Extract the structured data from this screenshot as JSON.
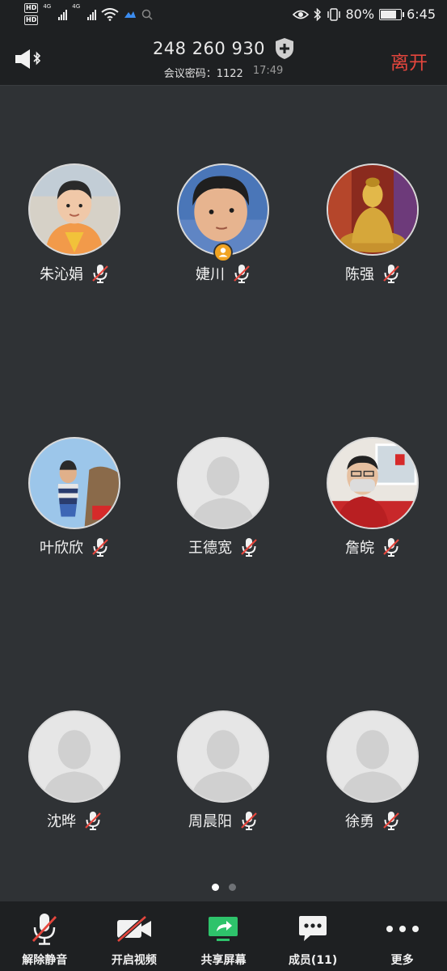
{
  "status_bar": {
    "hd_badges": [
      "HD",
      "HD"
    ],
    "network_labels": [
      "4G",
      "4G"
    ],
    "battery_percent": "80%",
    "battery_level": 0.8,
    "time": "6:45"
  },
  "header": {
    "meeting_id": "248 260 930",
    "password_label": "会议密码：",
    "password_value": "1122",
    "duration": "17:49",
    "leave_label": "离开"
  },
  "participants": [
    {
      "name": "朱沁娟",
      "avatar": "photo-child",
      "muted": true,
      "host": false
    },
    {
      "name": "婕川",
      "avatar": "photo-child-closeup",
      "muted": true,
      "host": true
    },
    {
      "name": "陈强",
      "avatar": "photo-buddha",
      "muted": true,
      "host": false
    },
    {
      "name": "叶欣欣",
      "avatar": "photo-child-outdoor",
      "muted": true,
      "host": false
    },
    {
      "name": "王德宽",
      "avatar": "default",
      "muted": true,
      "host": false
    },
    {
      "name": "詹皖",
      "avatar": "photo-person-mask",
      "muted": true,
      "host": false
    },
    {
      "name": "沈晔",
      "avatar": "default",
      "muted": true,
      "host": false
    },
    {
      "name": "周晨阳",
      "avatar": "default",
      "muted": true,
      "host": false
    },
    {
      "name": "徐勇",
      "avatar": "default",
      "muted": true,
      "host": false
    }
  ],
  "pager": {
    "pages": 2,
    "current": 1
  },
  "toolbar": {
    "unmute_label": "解除静音",
    "video_label": "开启视频",
    "share_label": "共享屏幕",
    "members_label": "成员(11)",
    "more_label": "更多"
  },
  "colors": {
    "background": "#2f3235",
    "bar": "#1e2022",
    "leave": "#e5463d",
    "muted_slash": "#e5463d",
    "share_green": "#2ec36b",
    "host_badge": "#f0a321"
  }
}
